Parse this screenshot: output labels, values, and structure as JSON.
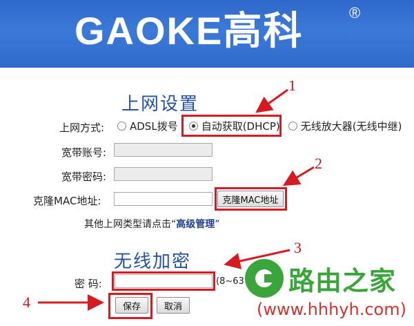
{
  "header": {
    "brand": "GAOKE高科",
    "registered": "®"
  },
  "internet": {
    "title": "上网设置",
    "mode_label": "上网方式:",
    "options": [
      "ADSL拨号",
      "自动获取(DHCP)",
      "无线放大器(无线中继)"
    ],
    "selected": "自动获取(DHCP)",
    "account_label": "宽带账号:",
    "password_label": "宽带密码:",
    "clone_mac_label": "克隆MAC地址:",
    "clone_mac_button": "克隆MAC地址",
    "advanced_hint_prefix": "其他上网类型请点击“",
    "advanced_link": "高级管理",
    "advanced_hint_suffix": "”"
  },
  "wireless": {
    "title": "无线加密",
    "password_label": "密  码:",
    "password_hint": "(8~63"
  },
  "actions": {
    "save": "保存",
    "cancel": "取消"
  },
  "annotations": [
    "1",
    "2",
    "3",
    "4"
  ],
  "watermark": {
    "name": "路由之家",
    "url": "(www.hhhyh.com)"
  },
  "colors": {
    "banner": "#2e67c9",
    "title": "#2452a8",
    "highlight": "#d81920",
    "watermark_green": "#3aa53a"
  }
}
